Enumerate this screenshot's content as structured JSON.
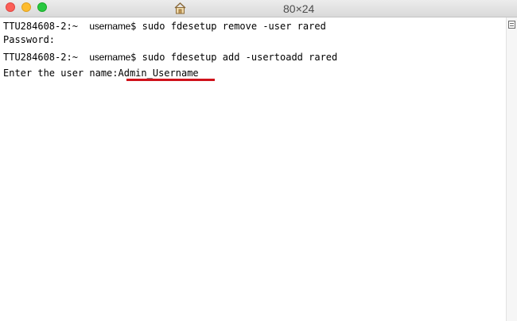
{
  "window": {
    "title": "80×24",
    "icon": "home-folder-icon"
  },
  "terminal": {
    "lines": [
      {
        "host": "TTU284608-2:~",
        "user": "username",
        "prompt": "$",
        "command": "sudo fdesetup remove -user rared"
      },
      {
        "text": "Password:"
      },
      {
        "host": "TTU284608-2:~",
        "user": "username",
        "prompt": "$",
        "command": "sudo fdesetup add -usertoadd rared"
      },
      {
        "label": "Enter the user name:",
        "value": "Admin_Username"
      }
    ],
    "highlight_color": "#d0121b"
  },
  "colors": {
    "close": "#fc5f57",
    "minimize": "#fdbc2e",
    "zoom": "#28c840"
  }
}
